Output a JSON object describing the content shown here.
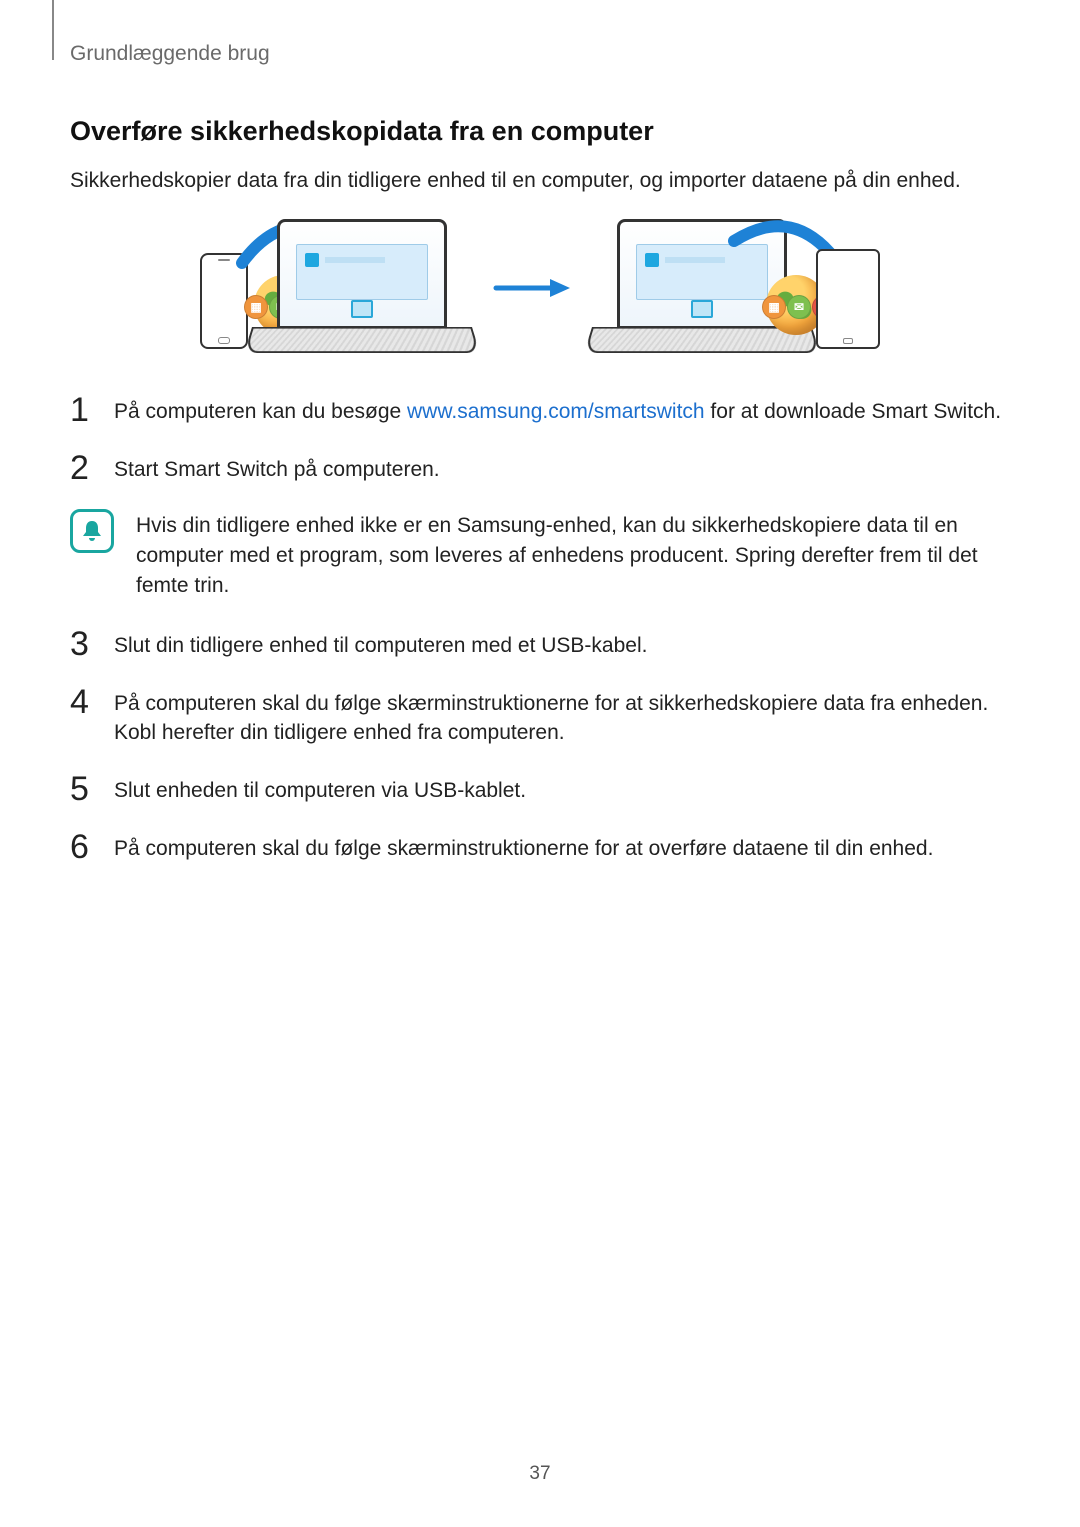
{
  "header": {
    "breadcrumb": "Grundlæggende brug"
  },
  "section": {
    "title": "Overføre sikkerhedskopidata fra en computer",
    "intro": "Sikkerhedskopier data fra din tidligere enhed til en computer, og importer dataene på din enhed."
  },
  "link": {
    "smartswitch_url": "www.samsung.com/smartswitch"
  },
  "steps": {
    "s1_num": "1",
    "s1_before": "På computeren kan du besøge ",
    "s1_after": " for at downloade Smart Switch.",
    "s2_num": "2",
    "s2": "Start Smart Switch på computeren.",
    "s3_num": "3",
    "s3": "Slut din tidligere enhed til computeren med et USB-kabel.",
    "s4_num": "4",
    "s4": "På computeren skal du følge skærminstruktionerne for at sikkerhedskopiere data fra enheden. Kobl herefter din tidligere enhed fra computeren.",
    "s5_num": "5",
    "s5": "Slut enheden til computeren via USB-kablet.",
    "s6_num": "6",
    "s6": "På computeren skal du følge skærminstruktionerne for at overføre dataene til din enhed."
  },
  "note": {
    "text": "Hvis din tidligere enhed ikke er en Samsung-enhed, kan du sikkerhedskopiere data til en computer med et program, som leveres af enhedens producent. Spring derefter frem til det femte trin."
  },
  "page_number": "37"
}
